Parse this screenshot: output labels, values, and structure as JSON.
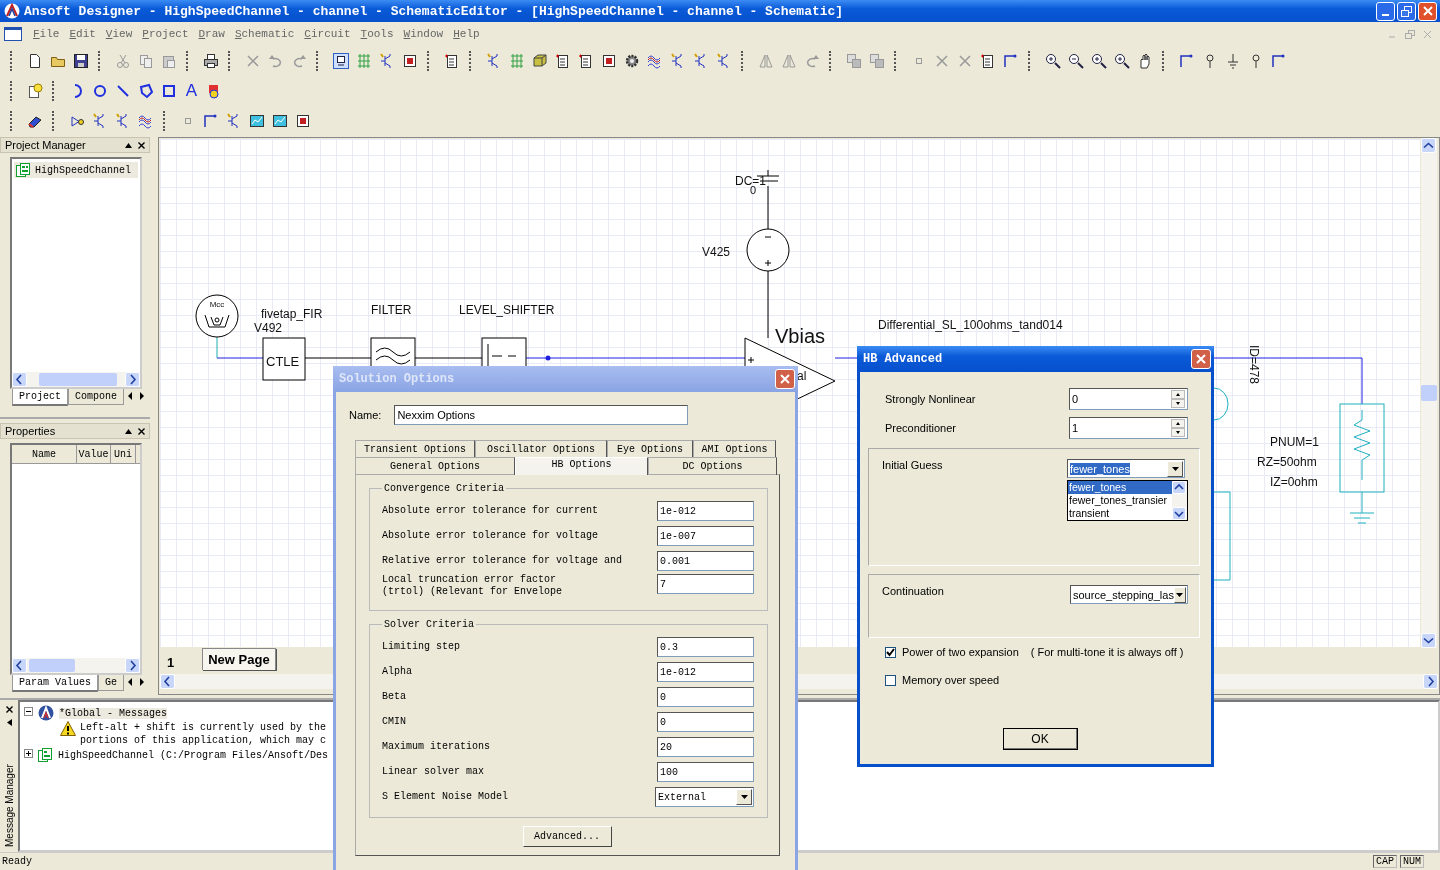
{
  "window": {
    "title": "Ansoft Designer - HighSpeedChannel - channel - SchematicEditor - [HighSpeedChannel - channel - Schematic]"
  },
  "menu": [
    "File",
    "Edit",
    "View",
    "Project",
    "Draw",
    "Schematic",
    "Circuit",
    "Tools",
    "Window",
    "Help"
  ],
  "toolbar": {
    "text_tool": "A"
  },
  "project_manager": {
    "title": "Project Manager",
    "items": [
      {
        "label": "HighSpeedChannel",
        "selected": true
      }
    ],
    "tabs": [
      {
        "label": "Project",
        "selected": true
      },
      {
        "label": "Compone",
        "selected": false
      }
    ]
  },
  "properties": {
    "title": "Properties",
    "columns": [
      "Name",
      "Value",
      "Uni"
    ],
    "tabs": [
      {
        "label": "Param Values",
        "selected": true
      },
      {
        "label": "Ge",
        "selected": false
      }
    ]
  },
  "schematic": {
    "labels": [
      {
        "text": "Mcc"
      },
      {
        "text": "DC=1"
      },
      {
        "text": "0"
      },
      {
        "text": "V425"
      },
      {
        "text": "fivetap_FIR"
      },
      {
        "text": "V492"
      },
      {
        "text": "CTLE"
      },
      {
        "text": "FILTER"
      },
      {
        "text": "LEVEL_SHIFTER"
      },
      {
        "text": "Vbias"
      },
      {
        "text": "al"
      },
      {
        "text": "Differential_SL_100ohms_tand014"
      },
      {
        "text": "ID=478"
      },
      {
        "text": "PNUM=1"
      },
      {
        "text": "RZ=50ohm"
      },
      {
        "text": "IZ=0ohm"
      }
    ],
    "page_number": "1",
    "page_tabs": [
      {
        "label": "New Page",
        "selected": true
      }
    ]
  },
  "messages": {
    "title": "Message Manager",
    "items": [
      {
        "label": "*Global - Messages",
        "expanded": true,
        "children": [
          {
            "kind": "warning",
            "text": "Left-alt + shift is currently used by the\nportions of this application, which may c"
          }
        ]
      },
      {
        "label": "HighSpeedChannel (C:/Program Files/Ansoft/Des",
        "expanded": false
      }
    ]
  },
  "status_bar": {
    "text": "Ready",
    "indicators": [
      "CAP",
      "NUM"
    ]
  },
  "solution_options": {
    "title": "Solution Options",
    "active": false,
    "name_label": "Name:",
    "name_value": "Nexxim Options",
    "tab_rows": [
      [
        {
          "label": "Transient Options",
          "selected": false
        },
        {
          "label": "Oscillator Options",
          "selected": false
        },
        {
          "label": "Eye Options",
          "selected": false
        },
        {
          "label": "AMI Options",
          "selected": false
        }
      ],
      [
        {
          "label": "General Options",
          "selected": false
        },
        {
          "label": "HB Options",
          "selected": true
        },
        {
          "label": "DC Options",
          "selected": false
        }
      ]
    ],
    "groups": [
      {
        "title": "Convergence Criteria",
        "fields": [
          {
            "label": "Absolute error tolerance for current",
            "value": "1e-012",
            "kind": "text"
          },
          {
            "label": "Absolute error tolerance for voltage",
            "value": "1e-007",
            "kind": "text"
          },
          {
            "label": "Relative error tolerance for voltage and",
            "value": "0.001",
            "kind": "text"
          },
          {
            "label": "Local truncation error factor\n(trtol) (Relevant for Envelope",
            "value": "7",
            "kind": "text"
          }
        ]
      },
      {
        "title": "Solver Criteria",
        "fields": [
          {
            "label": "Limiting step",
            "value": "0.3",
            "kind": "text"
          },
          {
            "label": "Alpha",
            "value": "1e-012",
            "kind": "text"
          },
          {
            "label": "Beta",
            "value": "0",
            "kind": "text"
          },
          {
            "label": "CMIN",
            "value": "0",
            "kind": "text"
          },
          {
            "label": "Maximum iterations",
            "value": "20",
            "kind": "text"
          },
          {
            "label": "Linear solver max",
            "value": "100",
            "kind": "text"
          },
          {
            "label": "S Element Noise Model",
            "value": "External",
            "kind": "dropdown"
          }
        ]
      }
    ],
    "button": "Advanced..."
  },
  "hb_advanced": {
    "title": "HB Advanced",
    "active": true,
    "fields": [
      {
        "label": "Strongly Nonlinear",
        "value": "0",
        "kind": "spin"
      },
      {
        "label": "Preconditioner",
        "value": "1",
        "kind": "spin"
      }
    ],
    "groups": [
      {
        "label": "Initial Guess",
        "value": "fewer_tones",
        "kind": "dropdown",
        "expanded": true,
        "options": [
          {
            "label": "fewer_tones",
            "selected": true
          },
          {
            "label": "fewer_tones_transier",
            "selected": false
          },
          {
            "label": "transient",
            "selected": false
          }
        ]
      },
      {
        "label": "Continuation",
        "value": "source_stepping_las",
        "kind": "dropdown",
        "expanded": false
      }
    ],
    "checkboxes": [
      {
        "label": "Power of two expansion",
        "note": "( For multi-tone it is always off )",
        "checked": true
      },
      {
        "label": "Memory over speed",
        "checked": false
      }
    ],
    "button": "OK"
  }
}
